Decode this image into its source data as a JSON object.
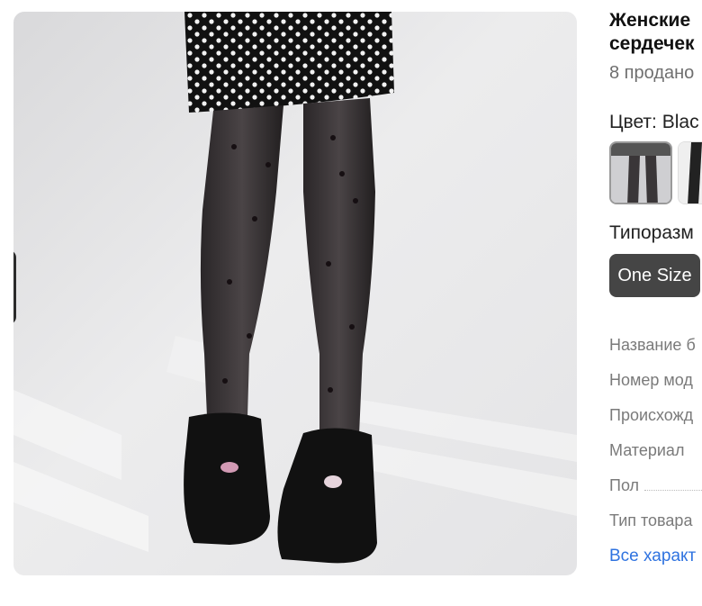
{
  "product": {
    "title": "Женские\nсердечек",
    "sold": "8 продано",
    "color_label": "Цвет: Blac",
    "size_label": "Типоразм",
    "size_option": "One Size"
  },
  "specs": [
    {
      "label": "Название б"
    },
    {
      "label": "Номер мод"
    },
    {
      "label": "Происхожд"
    },
    {
      "label": "Материал"
    },
    {
      "label": "Пол"
    },
    {
      "label": "Тип товара"
    }
  ],
  "all_specs_link": "Все характ",
  "colors": {
    "accent_link": "#2f73e0",
    "size_button_bg": "#454545"
  }
}
